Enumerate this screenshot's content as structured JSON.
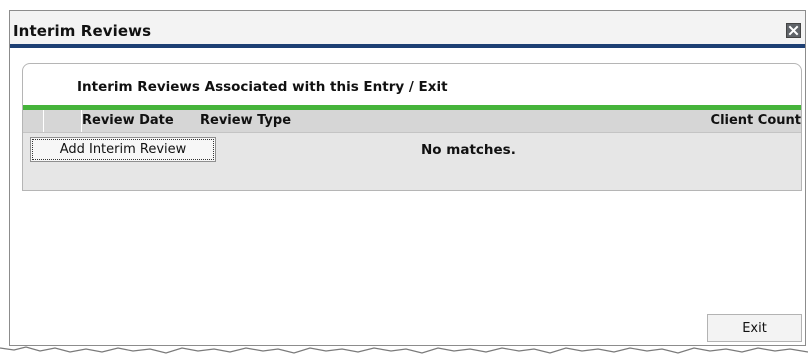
{
  "dialog": {
    "title": "Interim Reviews",
    "close_icon": "close-icon",
    "accent_colors": {
      "title_underline": "#1d3f73",
      "section_underline": "#46b43b"
    }
  },
  "section": {
    "title": "Interim Reviews Associated with this Entry / Exit",
    "table": {
      "columns": [
        "",
        "",
        "Review Date",
        "Review Type",
        "Client Count"
      ],
      "empty_text": "No matches."
    },
    "add_button_label": "Add Interim Review"
  },
  "footer": {
    "exit_label": "Exit"
  }
}
